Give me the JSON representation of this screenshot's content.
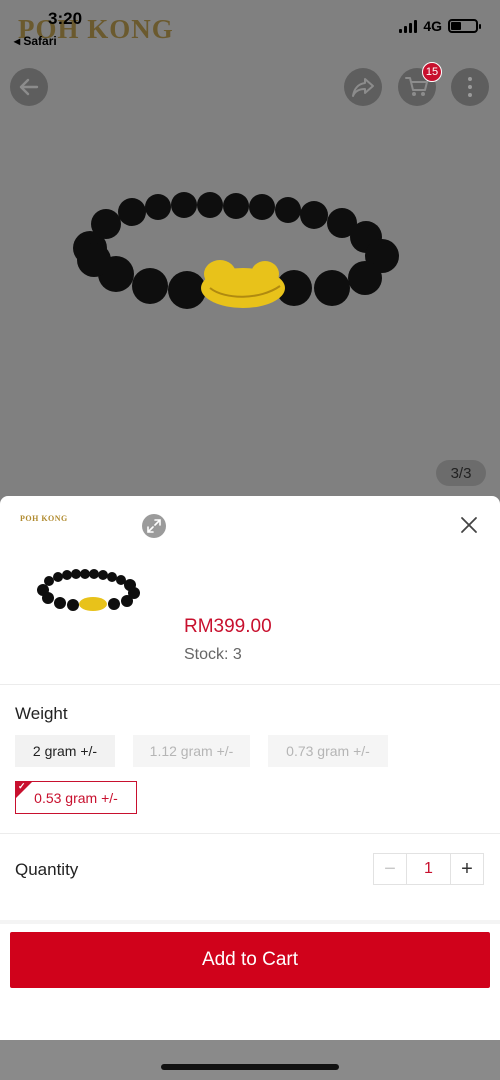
{
  "status_bar": {
    "time": "3:20",
    "back_app": "◂ Safari",
    "network": "4G"
  },
  "background": {
    "logo": "POH KONG",
    "cart_count": "15",
    "image_indicator": "3/3",
    "icons": [
      "back-arrow-icon",
      "share-icon",
      "cart-icon",
      "more-icon"
    ]
  },
  "sheet": {
    "thumb_logo": "POH KONG",
    "price": "RM399.00",
    "stock": "Stock: 3",
    "weight_label": "Weight",
    "weight_options": [
      {
        "label": "2 gram +/-",
        "state": "available"
      },
      {
        "label": "1.12 gram +/-",
        "state": "disabled"
      },
      {
        "label": "0.73 gram +/-",
        "state": "disabled"
      },
      {
        "label": "0.53 gram +/-",
        "state": "selected"
      }
    ],
    "quantity_label": "Quantity",
    "quantity_value": "1",
    "minus_symbol": "−",
    "plus_symbol": "+",
    "add_to_cart": "Add to Cart"
  },
  "colors": {
    "accent": "#c8102e",
    "button": "#d0021b"
  }
}
